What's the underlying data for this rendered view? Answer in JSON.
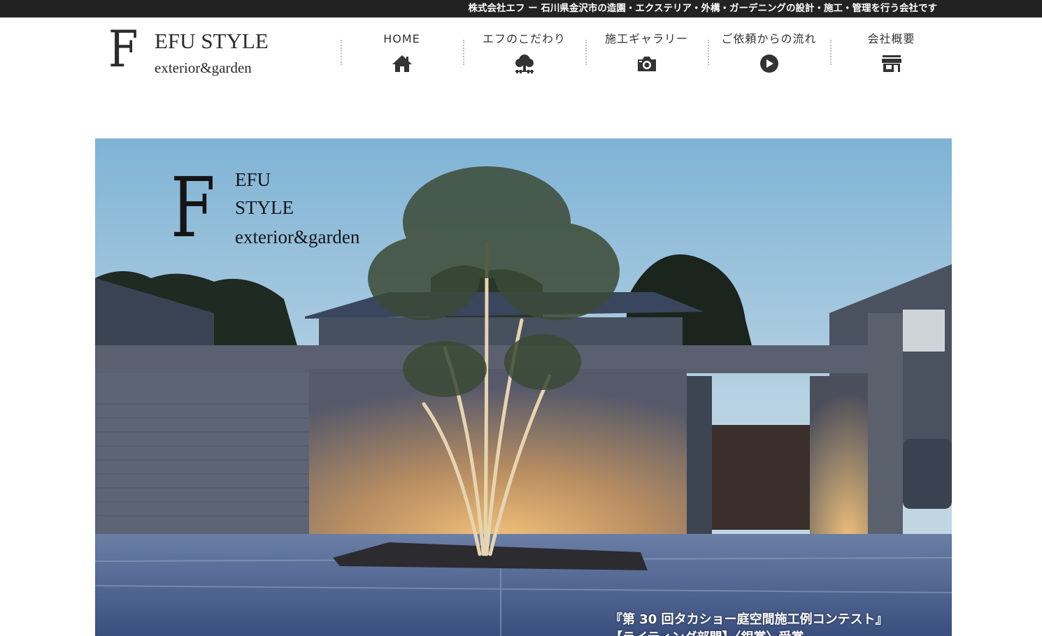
{
  "topbar": {
    "tagline": "株式会社エフ ー 石川県金沢市の造園・エクステリア・外構・ガーデニングの設計・施工・管理を行う会社です"
  },
  "logo": {
    "letter": "F",
    "name": "EFU STYLE",
    "tagline": "exterior&garden"
  },
  "nav": {
    "items": [
      {
        "label": "HOME",
        "icon": "home-icon"
      },
      {
        "label": "エフのこだわり",
        "icon": "tree-icon"
      },
      {
        "label": "施工ギャラリー",
        "icon": "camera-icon"
      },
      {
        "label": "ご依頼からの流れ",
        "icon": "play-circle-icon"
      },
      {
        "label": "会社概要",
        "icon": "store-icon"
      }
    ]
  },
  "hero": {
    "logo_letter": "F",
    "logo_line1": "EFU",
    "logo_line2": "STYLE",
    "logo_line3": "exterior&garden",
    "caption_line1": "『第 30 回タカショー庭空間施工例コンテスト』",
    "caption_line2": "【ライティング部門】〈銀賞〉受賞"
  },
  "colors": {
    "topbar_bg": "#222222",
    "text": "#333333",
    "logo": "#2b2b2b"
  }
}
